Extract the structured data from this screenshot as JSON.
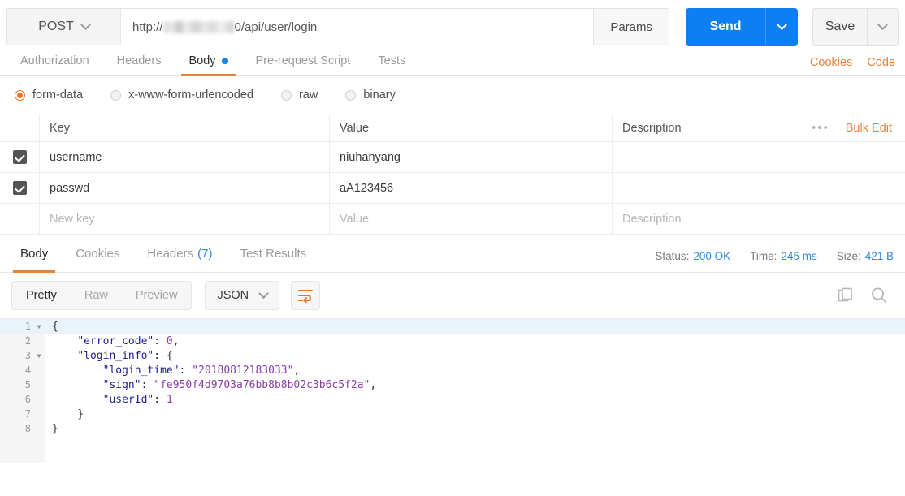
{
  "request": {
    "method": "POST",
    "url_prefix": "http://",
    "url_suffix": "0/api/user/login",
    "params_label": "Params",
    "send_label": "Send",
    "save_label": "Save"
  },
  "request_tabs": {
    "items": [
      {
        "label": "Authorization",
        "active": false,
        "dot": false
      },
      {
        "label": "Headers",
        "active": false,
        "dot": false
      },
      {
        "label": "Body",
        "active": true,
        "dot": true
      },
      {
        "label": "Pre-request Script",
        "active": false,
        "dot": false
      },
      {
        "label": "Tests",
        "active": false,
        "dot": false
      }
    ],
    "cookies_label": "Cookies",
    "code_label": "Code"
  },
  "body_type": {
    "options": [
      {
        "label": "form-data",
        "selected": true
      },
      {
        "label": "x-www-form-urlencoded",
        "selected": false
      },
      {
        "label": "raw",
        "selected": false
      },
      {
        "label": "binary",
        "selected": false
      }
    ]
  },
  "kv_table": {
    "headers": {
      "key": "Key",
      "value": "Value",
      "description": "Description"
    },
    "dots_label": "•••",
    "bulk_edit_label": "Bulk Edit",
    "rows": [
      {
        "checked": true,
        "key": "username",
        "value": "niuhanyang",
        "description": ""
      },
      {
        "checked": true,
        "key": "passwd",
        "value": "aA123456",
        "description": ""
      }
    ],
    "new_row": {
      "key": "New key",
      "value": "Value",
      "description": "Description"
    }
  },
  "response_tabs": {
    "items": [
      {
        "label": "Body",
        "count": "",
        "active": true
      },
      {
        "label": "Cookies",
        "count": "",
        "active": false
      },
      {
        "label": "Headers",
        "count": "(7)",
        "active": false
      },
      {
        "label": "Test Results",
        "count": "",
        "active": false
      }
    ],
    "meta": {
      "status_label": "Status:",
      "status_value": "200 OK",
      "time_label": "Time:",
      "time_value": "245 ms",
      "size_label": "Size:",
      "size_value": "421 B"
    }
  },
  "view_toolbar": {
    "segments": [
      {
        "label": "Pretty",
        "active": true
      },
      {
        "label": "Raw",
        "active": false
      },
      {
        "label": "Preview",
        "active": false
      }
    ],
    "format": "JSON"
  },
  "response_body": {
    "lines": [
      {
        "no": "1",
        "fold": true,
        "highlight": true,
        "tokens": [
          {
            "t": "{",
            "c": "p"
          }
        ]
      },
      {
        "no": "2",
        "fold": false,
        "highlight": false,
        "tokens": [
          {
            "t": "    ",
            "c": "p"
          },
          {
            "t": "\"error_code\"",
            "c": "k"
          },
          {
            "t": ": ",
            "c": "p"
          },
          {
            "t": "0",
            "c": "n"
          },
          {
            "t": ",",
            "c": "p"
          }
        ]
      },
      {
        "no": "3",
        "fold": true,
        "highlight": false,
        "tokens": [
          {
            "t": "    ",
            "c": "p"
          },
          {
            "t": "\"login_info\"",
            "c": "k"
          },
          {
            "t": ": {",
            "c": "p"
          }
        ]
      },
      {
        "no": "4",
        "fold": false,
        "highlight": false,
        "tokens": [
          {
            "t": "        ",
            "c": "p"
          },
          {
            "t": "\"login_time\"",
            "c": "k"
          },
          {
            "t": ": ",
            "c": "p"
          },
          {
            "t": "\"20180812183033\"",
            "c": "s"
          },
          {
            "t": ",",
            "c": "p"
          }
        ]
      },
      {
        "no": "5",
        "fold": false,
        "highlight": false,
        "tokens": [
          {
            "t": "        ",
            "c": "p"
          },
          {
            "t": "\"sign\"",
            "c": "k"
          },
          {
            "t": ": ",
            "c": "p"
          },
          {
            "t": "\"fe950f4d9703a76bb8b8b02c3b6c5f2a\"",
            "c": "s"
          },
          {
            "t": ",",
            "c": "p"
          }
        ]
      },
      {
        "no": "6",
        "fold": false,
        "highlight": false,
        "tokens": [
          {
            "t": "        ",
            "c": "p"
          },
          {
            "t": "\"userId\"",
            "c": "k"
          },
          {
            "t": ": ",
            "c": "p"
          },
          {
            "t": "1",
            "c": "n"
          }
        ]
      },
      {
        "no": "7",
        "fold": false,
        "highlight": false,
        "tokens": [
          {
            "t": "    }",
            "c": "p"
          }
        ]
      },
      {
        "no": "8",
        "fold": false,
        "highlight": false,
        "tokens": [
          {
            "t": "}",
            "c": "p"
          }
        ]
      }
    ]
  },
  "colors": {
    "accent_orange": "#e8833a",
    "send_blue": "#0f7ef2",
    "link_blue": "#2e8ae6",
    "radio_orange": "#f0712a"
  }
}
